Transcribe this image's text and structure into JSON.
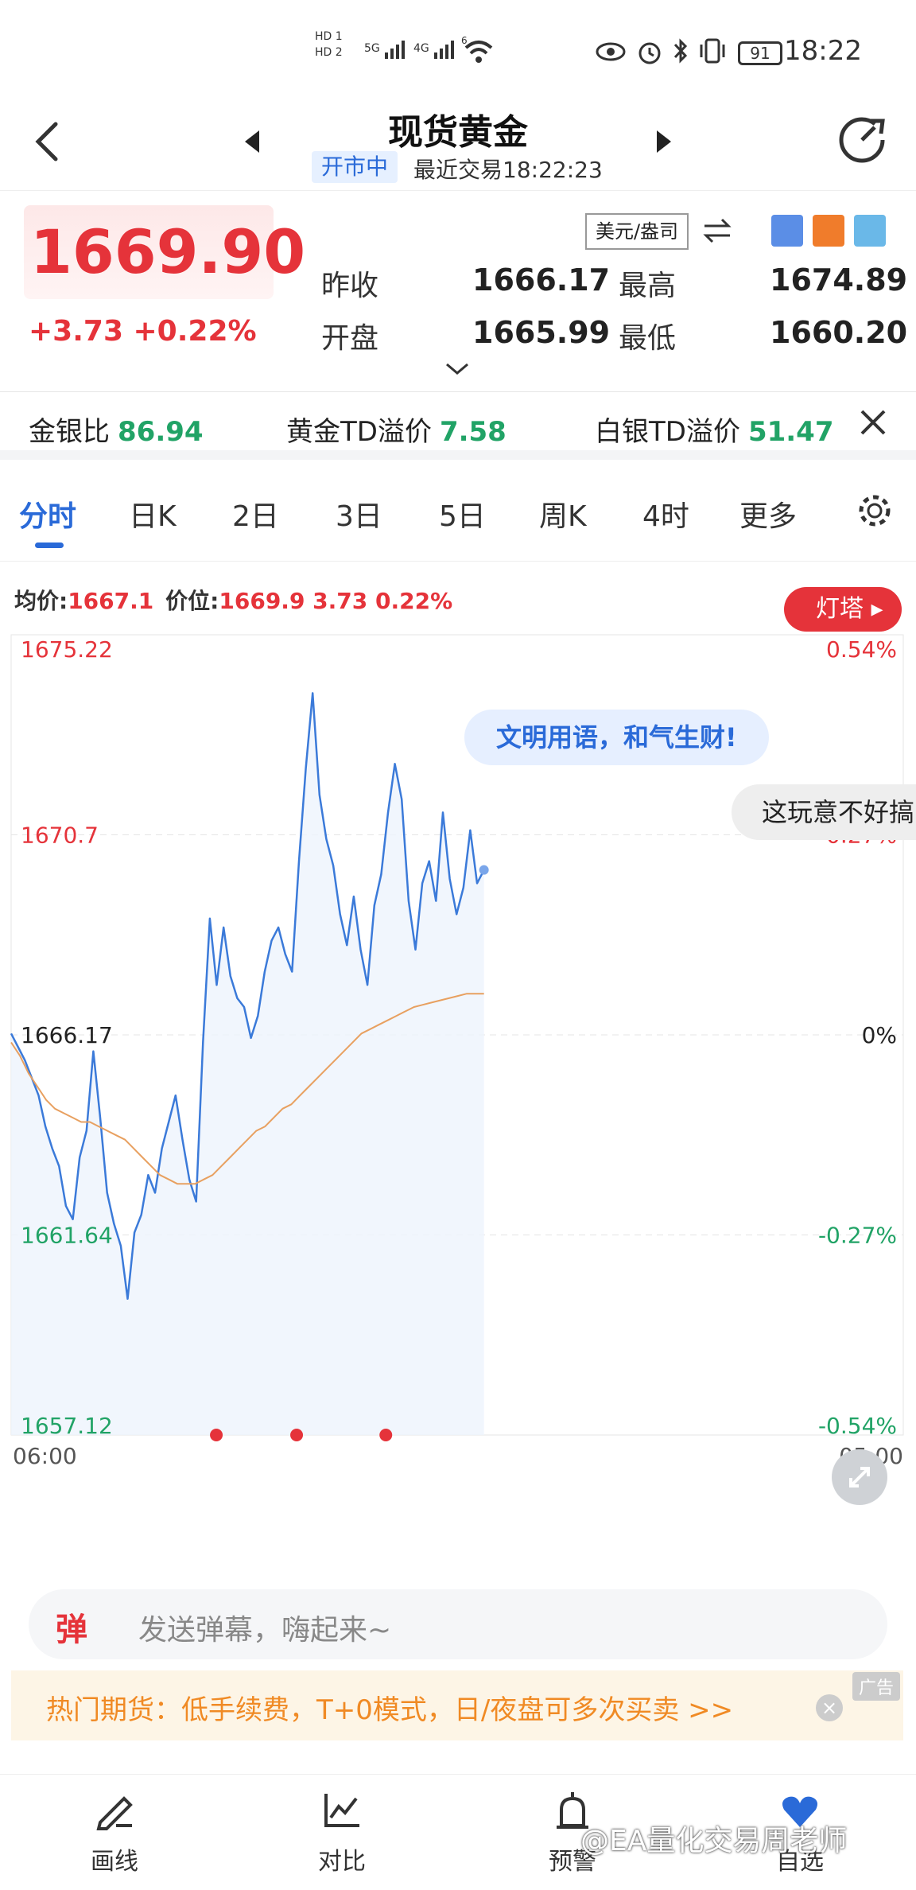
{
  "status_bar": {
    "hd1": "HD 1",
    "hd2": "HD 2",
    "net1": "5G",
    "net2": "4G",
    "wifi_badge": "6",
    "battery": "91",
    "time": "18:22"
  },
  "header": {
    "title": "现货黄金",
    "status_chip": "开市中",
    "last_trade": "最近交易18:22:23"
  },
  "quote": {
    "price": "1669.90",
    "change": "+3.73 +0.22%",
    "unit": "美元/盎司",
    "prev_close_label": "昨收",
    "prev_close": "1666.17",
    "high_label": "最高",
    "high": "1674.89",
    "open_label": "开盘",
    "open": "1665.99",
    "low_label": "最低",
    "low": "1660.20",
    "colors": {
      "up": "#e5333a",
      "down": "#21a366"
    }
  },
  "ratios": [
    {
      "label": "金银比",
      "value": "86.94"
    },
    {
      "label": "黄金TD溢价",
      "value": "7.58"
    },
    {
      "label": "白银TD溢价",
      "value": "51.47"
    }
  ],
  "tabs": [
    "分时",
    "日K",
    "2日",
    "3日",
    "5日",
    "周K",
    "4时",
    "更多"
  ],
  "active_tab": "分时",
  "chart_info": {
    "avg_label": "均价:",
    "avg_value": "1667.1",
    "price_label": "价位:",
    "price_value": "1669.9 3.73 0.22%",
    "lighthouse": "灯塔",
    "bubble1": "文明用语，和气生财!",
    "bubble2": "这玩意不好搞"
  },
  "chart_data": {
    "type": "line",
    "title": "",
    "xlabel": "",
    "ylabel": "",
    "x_ticks": [
      "06:00",
      "05:00"
    ],
    "y_ticks_left": [
      "1675.22",
      "1670.7",
      "1666.17",
      "1661.64",
      "1657.12"
    ],
    "y_ticks_right": [
      "0.54%",
      "0.27%",
      "0%",
      "-0.27%",
      "-0.54%"
    ],
    "ylim": [
      1657.12,
      1675.22
    ],
    "prev_close": 1666.17,
    "x_fraction_filled": 0.53,
    "series": [
      {
        "name": "价位",
        "color": "#3b7ad9",
        "values": [
          1666.2,
          1665.9,
          1665.6,
          1665.2,
          1664.8,
          1664.1,
          1663.6,
          1663.2,
          1662.3,
          1662.0,
          1663.4,
          1664.0,
          1665.8,
          1664.3,
          1662.6,
          1661.9,
          1661.4,
          1660.2,
          1661.7,
          1662.1,
          1663.0,
          1662.6,
          1663.6,
          1664.2,
          1664.8,
          1663.8,
          1662.9,
          1662.4,
          1666.0,
          1668.8,
          1667.3,
          1668.6,
          1667.5,
          1667.0,
          1666.8,
          1666.1,
          1666.6,
          1667.6,
          1668.3,
          1668.6,
          1668.0,
          1667.6,
          1670.1,
          1672.2,
          1673.9,
          1671.6,
          1670.6,
          1670.0,
          1668.9,
          1668.2,
          1669.3,
          1668.1,
          1667.3,
          1669.1,
          1669.8,
          1671.2,
          1672.3,
          1671.5,
          1669.2,
          1668.1,
          1669.6,
          1670.1,
          1669.2,
          1671.2,
          1669.7,
          1668.9,
          1669.5,
          1670.8,
          1669.6,
          1669.9
        ]
      },
      {
        "name": "均价",
        "color": "#e8a060",
        "values": [
          1666.0,
          1665.7,
          1665.3,
          1665.0,
          1664.7,
          1664.5,
          1664.4,
          1664.3,
          1664.2,
          1664.2,
          1664.1,
          1664.0,
          1663.9,
          1663.8,
          1663.6,
          1663.4,
          1663.2,
          1663.0,
          1662.9,
          1662.8,
          1662.8,
          1662.8,
          1662.9,
          1663.0,
          1663.2,
          1663.4,
          1663.6,
          1663.8,
          1664.0,
          1664.1,
          1664.3,
          1664.5,
          1664.6,
          1664.8,
          1665.0,
          1665.2,
          1665.4,
          1665.6,
          1665.8,
          1666.0,
          1666.2,
          1666.3,
          1666.4,
          1666.5,
          1666.6,
          1666.7,
          1666.8,
          1666.85,
          1666.9,
          1666.95,
          1667.0,
          1667.05,
          1667.1,
          1667.1,
          1667.1
        ]
      }
    ],
    "grid": true,
    "legend": "none"
  },
  "danmaku": {
    "icon": "弹",
    "placeholder": "发送弹幕，嗨起来~"
  },
  "ad": {
    "text": "热门期货：低手续费，T+0模式，日/夜盘可多次买卖 >>",
    "tag": "广告"
  },
  "bottom_nav": [
    {
      "label": "画线",
      "icon": "pencil-icon"
    },
    {
      "label": "对比",
      "icon": "chart-compare-icon"
    },
    {
      "label": "预警",
      "icon": "alarm-icon"
    },
    {
      "label": "自选",
      "icon": "heart-icon"
    }
  ],
  "watermark": "@EA量化交易周老师"
}
